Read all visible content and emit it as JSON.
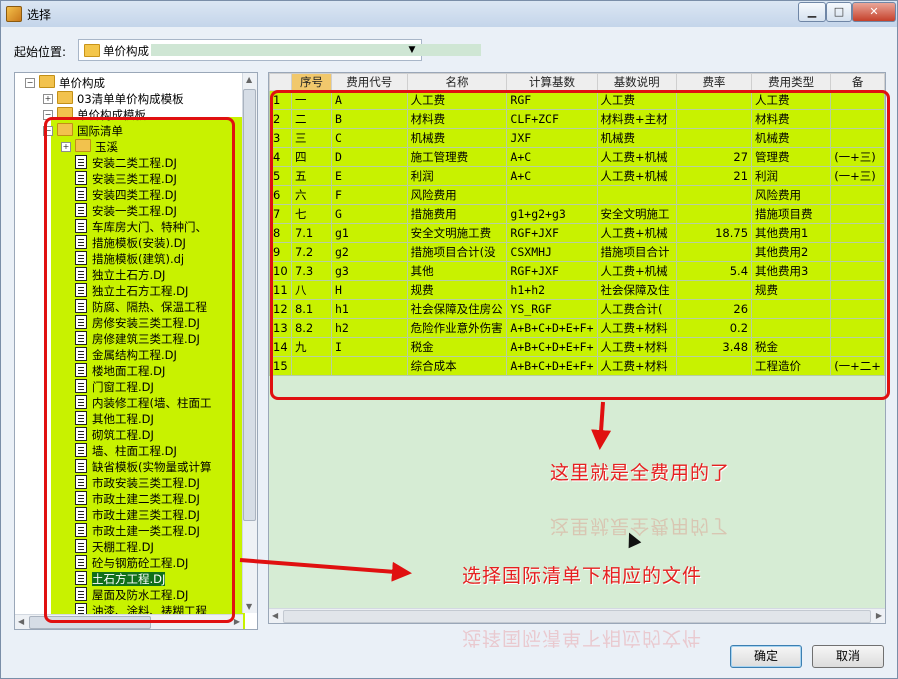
{
  "window": {
    "title": "选择",
    "min_label": "▁",
    "max_label": "□",
    "close_label": "✕"
  },
  "start": {
    "label": "起始位置:",
    "value": "单价构成"
  },
  "tree": [
    {
      "label": "单价构成",
      "type": "folder",
      "expander": "−",
      "level": 0
    },
    {
      "label": "03清单单价构成模板",
      "type": "folder",
      "expander": "+",
      "level": 1
    },
    {
      "label": "单价构成模板",
      "type": "folder",
      "expander": "−",
      "level": 1
    },
    {
      "label": "国际清单",
      "type": "folder",
      "expander": "−",
      "level": 2
    },
    {
      "label": "玉溪",
      "type": "folder",
      "expander": "+",
      "level": 3
    },
    {
      "label": "安装二类工程.DJ",
      "type": "file",
      "level": 3
    },
    {
      "label": "安装三类工程.DJ",
      "type": "file",
      "level": 3
    },
    {
      "label": "安装四类工程.DJ",
      "type": "file",
      "level": 3
    },
    {
      "label": "安装一类工程.DJ",
      "type": "file",
      "level": 3
    },
    {
      "label": "车库房大门、特种门、",
      "type": "file",
      "level": 3
    },
    {
      "label": "措施模板(安装).DJ",
      "type": "file",
      "level": 3
    },
    {
      "label": "措施模板(建筑).dj",
      "type": "file",
      "level": 3
    },
    {
      "label": "独立土石方.DJ",
      "type": "file",
      "level": 3
    },
    {
      "label": "独立土石方工程.DJ",
      "type": "file",
      "level": 3
    },
    {
      "label": "防腐、隔热、保温工程",
      "type": "file",
      "level": 3
    },
    {
      "label": "房修安装三类工程.DJ",
      "type": "file",
      "level": 3
    },
    {
      "label": "房修建筑三类工程.DJ",
      "type": "file",
      "level": 3
    },
    {
      "label": "金属结构工程.DJ",
      "type": "file",
      "level": 3
    },
    {
      "label": "楼地面工程.DJ",
      "type": "file",
      "level": 3
    },
    {
      "label": "门窗工程.DJ",
      "type": "file",
      "level": 3
    },
    {
      "label": "内装修工程(墙、柱面工",
      "type": "file",
      "level": 3
    },
    {
      "label": "其他工程.DJ",
      "type": "file",
      "level": 3
    },
    {
      "label": "砌筑工程.DJ",
      "type": "file",
      "level": 3
    },
    {
      "label": "墙、柱面工程.DJ",
      "type": "file",
      "level": 3
    },
    {
      "label": "缺省模板(实物量或计算",
      "type": "file",
      "level": 3
    },
    {
      "label": "市政安装三类工程.DJ",
      "type": "file",
      "level": 3
    },
    {
      "label": "市政土建二类工程.DJ",
      "type": "file",
      "level": 3
    },
    {
      "label": "市政土建三类工程.DJ",
      "type": "file",
      "level": 3
    },
    {
      "label": "市政土建一类工程.DJ",
      "type": "file",
      "level": 3
    },
    {
      "label": "天棚工程.DJ",
      "type": "file",
      "level": 3
    },
    {
      "label": "砼与钢筋砼工程.DJ",
      "type": "file",
      "level": 3
    },
    {
      "label": "土石方工程.DJ",
      "type": "file",
      "level": 3,
      "selected": true
    },
    {
      "label": "屋面及防水工程.DJ",
      "type": "file",
      "level": 3
    },
    {
      "label": "油漆、涂料、裱糊工程",
      "type": "file",
      "level": 3
    }
  ],
  "grid": {
    "headers": [
      "序号",
      "费用代号",
      "名称",
      "计算基数",
      "基数说明",
      "费率",
      "费用类型",
      "备"
    ],
    "rows": [
      [
        "1",
        "一",
        "A",
        "人工费",
        "RGF",
        "人工费",
        "",
        "人工费",
        ""
      ],
      [
        "2",
        "二",
        "B",
        "材料费",
        "CLF+ZCF",
        "材料费+主材",
        "",
        "材料费",
        ""
      ],
      [
        "3",
        "三",
        "C",
        "机械费",
        "JXF",
        "机械费",
        "",
        "机械费",
        ""
      ],
      [
        "4",
        "四",
        "D",
        "施工管理费",
        "A+C",
        "人工费+机械",
        "27",
        "管理费",
        "(一+三)"
      ],
      [
        "5",
        "五",
        "E",
        "利润",
        "A+C",
        "人工费+机械",
        "21",
        "利润",
        "(一+三)"
      ],
      [
        "6",
        "六",
        "F",
        "风险费用",
        "",
        "",
        "",
        "风险费用",
        ""
      ],
      [
        "7",
        "七",
        "G",
        "措施费用",
        "g1+g2+g3",
        "安全文明施工",
        "",
        "措施项目费",
        ""
      ],
      [
        "8",
        "7.1",
        "g1",
        "安全文明施工费",
        "RGF+JXF",
        "人工费+机械",
        "18.75",
        "其他费用1",
        ""
      ],
      [
        "9",
        "7.2",
        "g2",
        "措施项目合计(没",
        "CSXMHJ",
        "措施项目合计",
        "",
        "其他费用2",
        ""
      ],
      [
        "10",
        "7.3",
        "g3",
        "其他",
        "RGF+JXF",
        "人工费+机械",
        "5.4",
        "其他费用3",
        ""
      ],
      [
        "11",
        "八",
        "H",
        "规费",
        "h1+h2",
        "社会保障及住",
        "",
        "规费",
        ""
      ],
      [
        "12",
        "8.1",
        "h1",
        "社会保障及住房公",
        "YS_RGF",
        "人工费合计(",
        "26",
        "",
        ""
      ],
      [
        "13",
        "8.2",
        "h2",
        "危险作业意外伤害",
        "A+B+C+D+E+F+",
        "人工费+材料",
        "0.2",
        "",
        ""
      ],
      [
        "14",
        "九",
        "I",
        "税金",
        "A+B+C+D+E+F+",
        "人工费+材料",
        "3.48",
        "税金",
        ""
      ],
      [
        "15",
        "",
        "",
        "综合成本",
        "A+B+C+D+E+F+",
        "人工费+材料",
        "",
        "工程造价",
        "(一+二+"
      ]
    ]
  },
  "annotations": {
    "grid_note": "这里就是全费用的了",
    "tree_note": "选择国际清单下相应的文件"
  },
  "buttons": {
    "ok": "确定",
    "cancel": "取消"
  },
  "colors": {
    "highlight": "#c8f200",
    "annotation_red": "#e01010",
    "grid_bg": "#d6ecd4"
  }
}
